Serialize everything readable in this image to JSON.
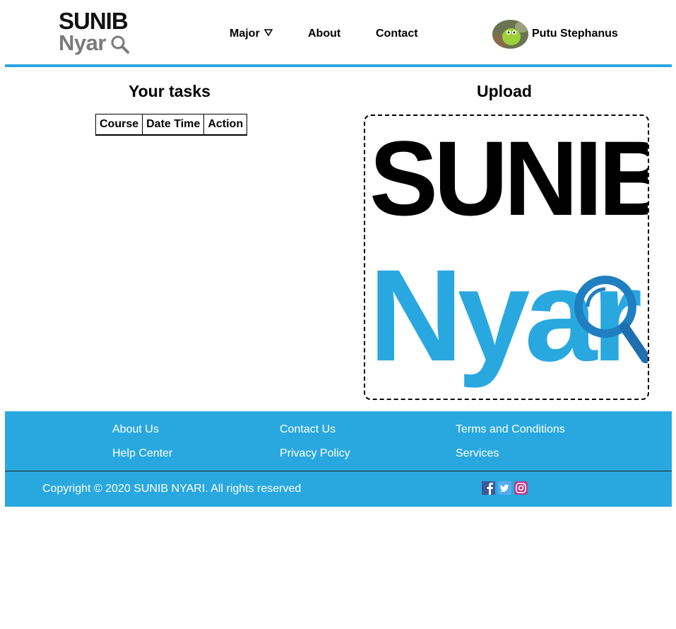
{
  "brand": {
    "line1": "SUNIB",
    "line2": "Nyar"
  },
  "nav": {
    "major": "Major",
    "about": "About",
    "contact": "Contact"
  },
  "user": {
    "name": "Putu Stephanus"
  },
  "tasks": {
    "title": "Your tasks",
    "columns": [
      "Course",
      "Date Time",
      "Action"
    ]
  },
  "upload": {
    "title": "Upload",
    "logo_line1": "SUNIB",
    "logo_line2": "Nyar"
  },
  "footer": {
    "links": [
      "About Us",
      "Contact Us",
      "Terms and Conditions",
      "Help Center",
      "Privacy Policy",
      "Services"
    ],
    "copyright": "Copyright © 2020 SUNIB NYARI. All rights reserved"
  },
  "colors": {
    "accent": "#29a8e0",
    "logo_gray": "#7a7a7a"
  },
  "icons": [
    "magnifier-icon",
    "caret-down-icon",
    "facebook-icon",
    "twitter-icon",
    "instagram-icon"
  ]
}
